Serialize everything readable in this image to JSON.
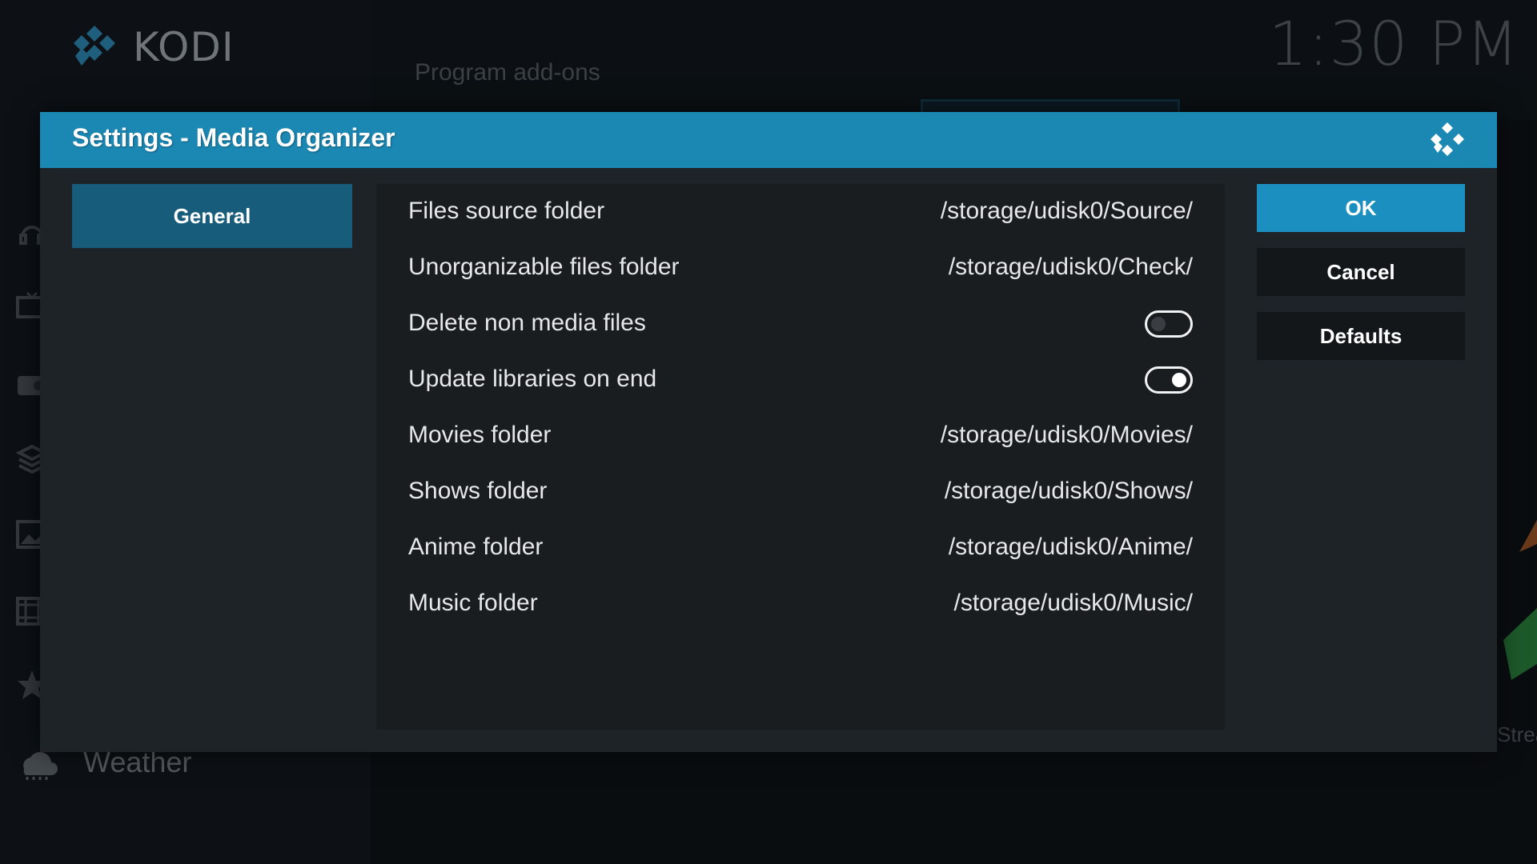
{
  "app": {
    "brand": "KODI",
    "clock": "1:30 PM",
    "background_heading": "Program add-ons",
    "weather_label": "Weather",
    "stream_fragment": "Strea"
  },
  "colors": {
    "header_blue": "#1b88b4",
    "selected_category": "#175d7b",
    "ok_button": "#1b8fc0",
    "dialog_bg": "#1e2327",
    "panel_bg": "#1a1d20"
  },
  "dialog": {
    "title": "Settings - Media Organizer",
    "logo_icon": "kodi-logo-icon",
    "categories": [
      {
        "label": "General",
        "selected": true
      }
    ],
    "settings": [
      {
        "label": "Files source folder",
        "value": "/storage/udisk0/Source/",
        "kind": "text"
      },
      {
        "label": "Unorganizable files folder",
        "value": "/storage/udisk0/Check/",
        "kind": "text"
      },
      {
        "label": "Delete non media files",
        "kind": "toggle",
        "enabled": false
      },
      {
        "label": "Update libraries on end",
        "kind": "toggle",
        "enabled": true
      },
      {
        "label": "Movies folder",
        "value": "/storage/udisk0/Movies/",
        "kind": "text"
      },
      {
        "label": "Shows folder",
        "value": "/storage/udisk0/Shows/",
        "kind": "text"
      },
      {
        "label": "Anime folder",
        "value": "/storage/udisk0/Anime/",
        "kind": "text"
      },
      {
        "label": "Music folder",
        "value": "/storage/udisk0/Music/",
        "kind": "text"
      }
    ],
    "buttons": {
      "ok": "OK",
      "cancel": "Cancel",
      "defaults": "Defaults"
    }
  }
}
